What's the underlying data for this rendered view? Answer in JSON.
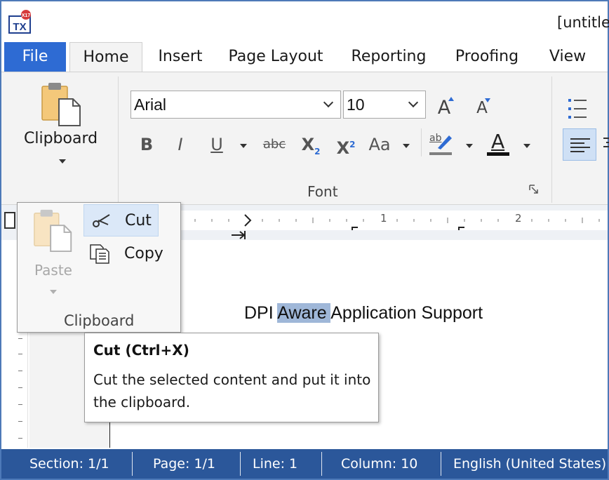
{
  "window": {
    "title": "[untitle",
    "logo_icon": "tx-logo-icon"
  },
  "tabs": [
    {
      "label": "File"
    },
    {
      "label": "Home"
    },
    {
      "label": "Insert"
    },
    {
      "label": "Page Layout"
    },
    {
      "label": "Reporting"
    },
    {
      "label": "Proofing"
    },
    {
      "label": "View"
    }
  ],
  "ribbon": {
    "clipboard_label": "Clipboard",
    "font": {
      "family": "Arial",
      "size": "10",
      "group_label": "Font",
      "bold": "B",
      "italic": "I",
      "underline": "U",
      "strikethrough": "abc",
      "subscript": "X",
      "subscript_mark": "2",
      "superscript": "X",
      "superscript_mark": "2",
      "change_case": "Aa",
      "highlight_text": "ab",
      "font_color_letter": "A",
      "grow_letter": "A",
      "shrink_letter": "A"
    }
  },
  "clipboard_popup": {
    "paste_label": "Paste",
    "cut_label": "Cut",
    "copy_label": "Copy",
    "group_label": "Clipboard"
  },
  "ruler": {
    "mark_1": "1",
    "mark_2": "2"
  },
  "document": {
    "text_before": "DPI ",
    "text_selected": "Aware ",
    "text_after": "Application Support"
  },
  "tooltip": {
    "title": "Cut (Ctrl+X)",
    "body": "Cut the selected content and put it into the clipboard."
  },
  "statusbar": {
    "section": "Section: 1/1",
    "page": "Page: 1/1",
    "line": "Line: 1",
    "column": "Column: 10",
    "language": "English (United States)"
  },
  "colors": {
    "file_tab": "#2e6bd3",
    "statusbar": "#2b579a",
    "selection": "#9fb7d8",
    "hover": "#dbe8f8"
  }
}
